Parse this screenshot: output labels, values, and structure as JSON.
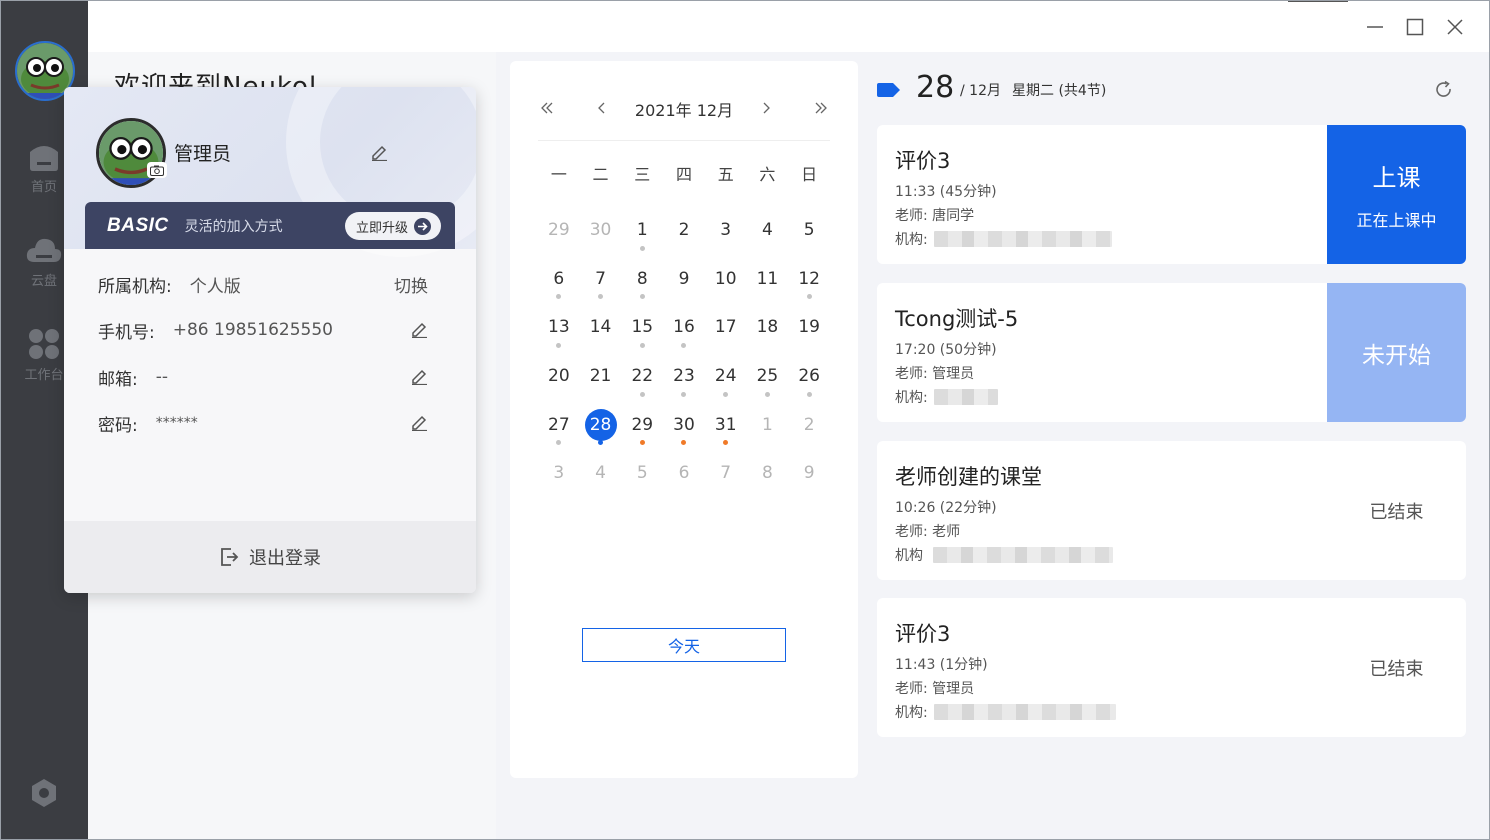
{
  "window": {
    "minimize_icon": "minimize-icon",
    "maximize_icon": "maximize-icon",
    "close_icon": "close-icon"
  },
  "sidebar": {
    "items": [
      {
        "label": "首页",
        "icon": "home-icon"
      },
      {
        "label": "云盘",
        "icon": "cloud-icon"
      },
      {
        "label": "工作台",
        "icon": "grid-icon"
      }
    ],
    "settings_icon": "settings-icon"
  },
  "welcome": "欢迎来到Neukol",
  "profile": {
    "username": "管理员",
    "plan": "BASIC",
    "plan_desc": "灵活的加入方式",
    "upgrade_label": "立即升级",
    "org_label": "所属机构:",
    "org_value": "个人版",
    "switch_label": "切换",
    "phone_label": "手机号:",
    "phone_value": "+86 19851625550",
    "email_label": "邮箱:",
    "email_value": "--",
    "password_label": "密码:",
    "password_value": "******",
    "logout_label": "退出登录"
  },
  "calendar": {
    "title": "2021年 12月",
    "weekdays": [
      "一",
      "二",
      "三",
      "四",
      "五",
      "六",
      "日"
    ],
    "days": [
      {
        "d": "29",
        "other": true
      },
      {
        "d": "30",
        "other": true
      },
      {
        "d": "1",
        "dot": "grey"
      },
      {
        "d": "2"
      },
      {
        "d": "3"
      },
      {
        "d": "4"
      },
      {
        "d": "5"
      },
      {
        "d": "6",
        "dot": "grey"
      },
      {
        "d": "7",
        "dot": "grey"
      },
      {
        "d": "8",
        "dot": "grey"
      },
      {
        "d": "9"
      },
      {
        "d": "10"
      },
      {
        "d": "11"
      },
      {
        "d": "12",
        "dot": "grey"
      },
      {
        "d": "13",
        "dot": "grey"
      },
      {
        "d": "14"
      },
      {
        "d": "15",
        "dot": "grey"
      },
      {
        "d": "16",
        "dot": "grey"
      },
      {
        "d": "17"
      },
      {
        "d": "18"
      },
      {
        "d": "19"
      },
      {
        "d": "20"
      },
      {
        "d": "21"
      },
      {
        "d": "22",
        "dot": "grey"
      },
      {
        "d": "23",
        "dot": "grey"
      },
      {
        "d": "24",
        "dot": "grey"
      },
      {
        "d": "25",
        "dot": "grey"
      },
      {
        "d": "26",
        "dot": "grey"
      },
      {
        "d": "27",
        "dot": "grey"
      },
      {
        "d": "28",
        "selected": true,
        "dot": "blue"
      },
      {
        "d": "29",
        "dot": "orange"
      },
      {
        "d": "30",
        "dot": "orange"
      },
      {
        "d": "31",
        "dot": "orange"
      },
      {
        "d": "1",
        "other": true
      },
      {
        "d": "2",
        "other": true
      },
      {
        "d": "3",
        "other": true
      },
      {
        "d": "4",
        "other": true
      },
      {
        "d": "5",
        "other": true
      },
      {
        "d": "6",
        "other": true
      },
      {
        "d": "7",
        "other": true
      },
      {
        "d": "8",
        "other": true
      },
      {
        "d": "9",
        "other": true
      }
    ],
    "today_label": "今天"
  },
  "colors": {
    "primary": "#1463e6",
    "pending": "#95b5f3",
    "dot_grey": "#c4c4c4",
    "dot_orange": "#f07a28",
    "dot_blue": "#1463e6",
    "sidebar": "#3b3d42"
  },
  "schedule": {
    "day": "28",
    "month": "/ 12月",
    "weekday": "星期二 (共4节)"
  },
  "lessons": [
    {
      "title": "评价3",
      "time": "11:33  (45分钟)",
      "teacher": "老师: 唐同学",
      "org_label": "机构:",
      "status_main": "上课",
      "status_sub": "正在上课中",
      "state": "active"
    },
    {
      "title": "Tcong测试-5",
      "time": "17:20  (50分钟)",
      "teacher": "老师: 管理员",
      "org_label": "机构:",
      "status_main": "未开始",
      "status_sub": "",
      "state": "pending"
    },
    {
      "title": "老师创建的课堂",
      "time": "10:26  (22分钟)",
      "teacher": "老师: 老师",
      "org_label": "机构",
      "status_main": "已结束",
      "status_sub": "",
      "state": "ended"
    },
    {
      "title": "评价3",
      "time": "11:43  (1分钟)",
      "teacher": "老师: 管理员",
      "org_label": "机构:",
      "status_main": "已结束",
      "status_sub": "",
      "state": "ended"
    }
  ]
}
